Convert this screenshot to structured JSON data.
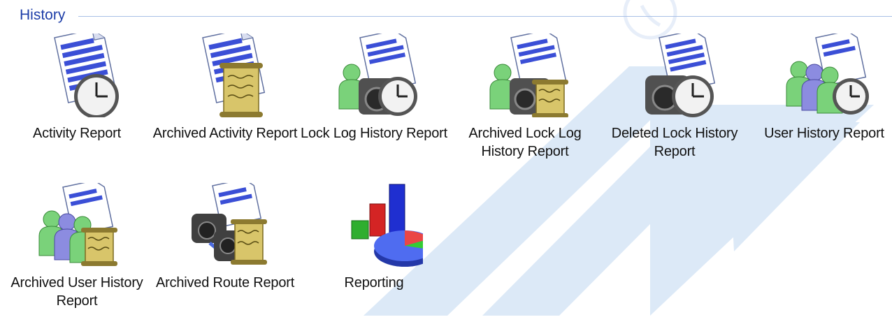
{
  "section": {
    "title": "History"
  },
  "tiles": [
    {
      "label": "Activity Report",
      "icon": "document-clock-icon"
    },
    {
      "label": "Archived Activity Report",
      "icon": "document-scroll-icon"
    },
    {
      "label": "Lock Log History Report",
      "icon": "user-lock-clock-icon"
    },
    {
      "label": "Archived Lock Log History Report",
      "icon": "user-lock-scroll-icon"
    },
    {
      "label": "Deleted Lock History Report",
      "icon": "lock-clock-icon"
    },
    {
      "label": "User History Report",
      "icon": "users-clock-icon"
    },
    {
      "label": "Archived User History Report",
      "icon": "users-scroll-icon"
    },
    {
      "label": "Archived Route Report",
      "icon": "route-scroll-icon"
    },
    {
      "label": "Reporting",
      "icon": "bar-pie-chart-icon"
    }
  ],
  "colors": {
    "header_text": "#1e3ea8",
    "header_rule": "#a8bfe6",
    "watermark": "#dce9f7"
  }
}
